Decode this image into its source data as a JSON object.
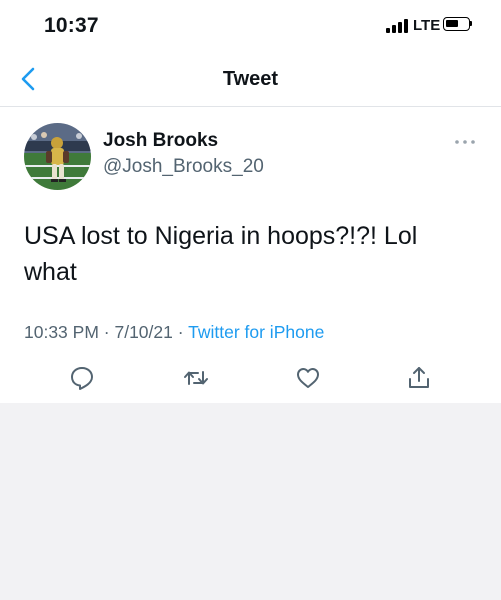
{
  "status_bar": {
    "time": "10:37",
    "network": "LTE"
  },
  "nav": {
    "title": "Tweet"
  },
  "tweet": {
    "display_name": "Josh Brooks",
    "handle": "@Josh_Brooks_20",
    "text": "USA lost to Nigeria in hoops?!?! Lol what",
    "time": "10:33 PM",
    "date": "7/10/21",
    "source": "Twitter for iPhone"
  },
  "colors": {
    "accent": "#1d9bf0",
    "secondary_text": "#536471",
    "primary_text": "#0f1419",
    "divider": "#e1e4e8"
  }
}
